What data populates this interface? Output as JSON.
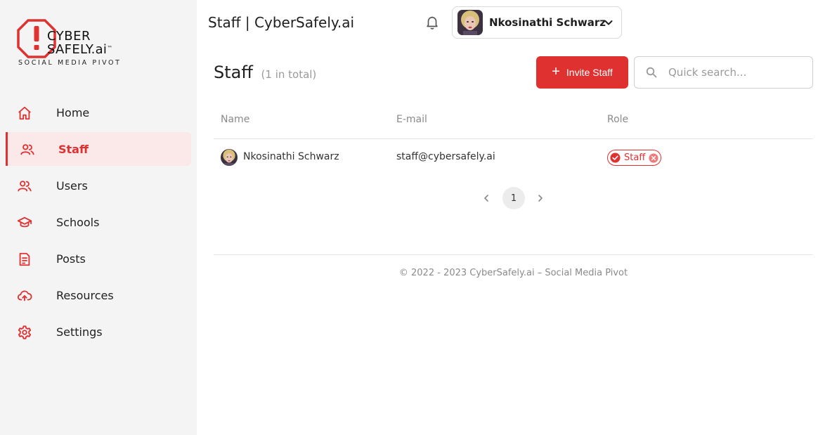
{
  "brand": {
    "line1": "CYBER",
    "line2": "SAFELY.ai",
    "tm": "™",
    "tagline": "SOCIAL MEDIA PIVOT",
    "accent_color": "#e03131"
  },
  "sidebar": {
    "items": [
      {
        "label": "Home",
        "icon": "home-icon",
        "active": false
      },
      {
        "label": "Staff",
        "icon": "staff-icon",
        "active": true
      },
      {
        "label": "Users",
        "icon": "users-icon",
        "active": false
      },
      {
        "label": "Schools",
        "icon": "school-icon",
        "active": false
      },
      {
        "label": "Posts",
        "icon": "posts-icon",
        "active": false
      },
      {
        "label": "Resources",
        "icon": "cloud-upload-icon",
        "active": false
      },
      {
        "label": "Settings",
        "icon": "gear-icon",
        "active": false
      }
    ]
  },
  "header": {
    "title": "Staff | CyberSafely.ai",
    "user_name": "Nkosinathi Schwarz"
  },
  "page": {
    "title": "Staff",
    "count": "(1 in total)",
    "invite_label": "Invite Staff",
    "search_placeholder": "Quick search..."
  },
  "table": {
    "columns": [
      "Name",
      "E-mail",
      "Role"
    ],
    "rows": [
      {
        "name": "Nkosinathi Schwarz",
        "email": "staff@cybersafely.ai",
        "role": "Staff"
      }
    ]
  },
  "pagination": {
    "current": "1"
  },
  "footer": {
    "text": "© 2022 - 2023 CyberSafely.ai – Social Media Pivot"
  }
}
